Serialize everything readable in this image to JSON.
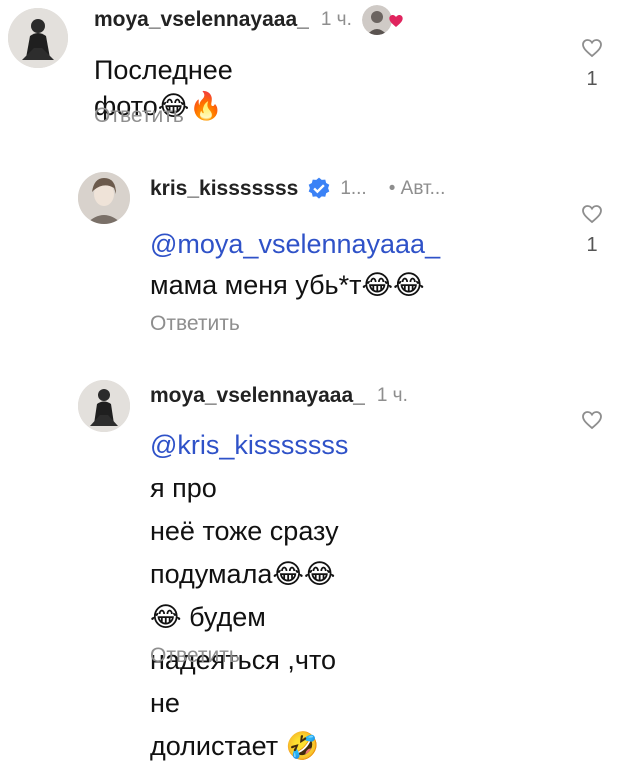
{
  "comments": [
    {
      "username": "moya_vselennayaaa_",
      "time": "1 ч.",
      "body": "Последнее фото",
      "body_emoji": "😂🔥",
      "reply_label": "Ответить",
      "likes": "1",
      "liked_by_author": true
    },
    {
      "username": "kris_kisssssss",
      "time": "1...",
      "author_badge": "• Авт...",
      "mention": "@moya_vselennayaaa_",
      "body": "мама меня убь*т",
      "body_emoji": "😂😂",
      "reply_label": "Ответить",
      "likes": "1",
      "verified": true
    },
    {
      "username": "moya_vselennayaaa_",
      "time": "1 ч.",
      "mention": "@kris_kisssssss",
      "body_line1": " я про",
      "body_line2": "неё тоже сразу",
      "body_line3a": "подумала",
      "body_line3_emoji": "😂😂😂",
      "body_line3b": " будем",
      "body_line4": "надеяться ,что не",
      "body_line5": "долистает ",
      "body_line5_emoji": "🤣",
      "reply_label": "Ответить"
    }
  ],
  "colors": {
    "mention": "#2f52c8",
    "heart": "#e0245e",
    "verified": "#3b82f6",
    "muted": "#8e8e8e"
  }
}
